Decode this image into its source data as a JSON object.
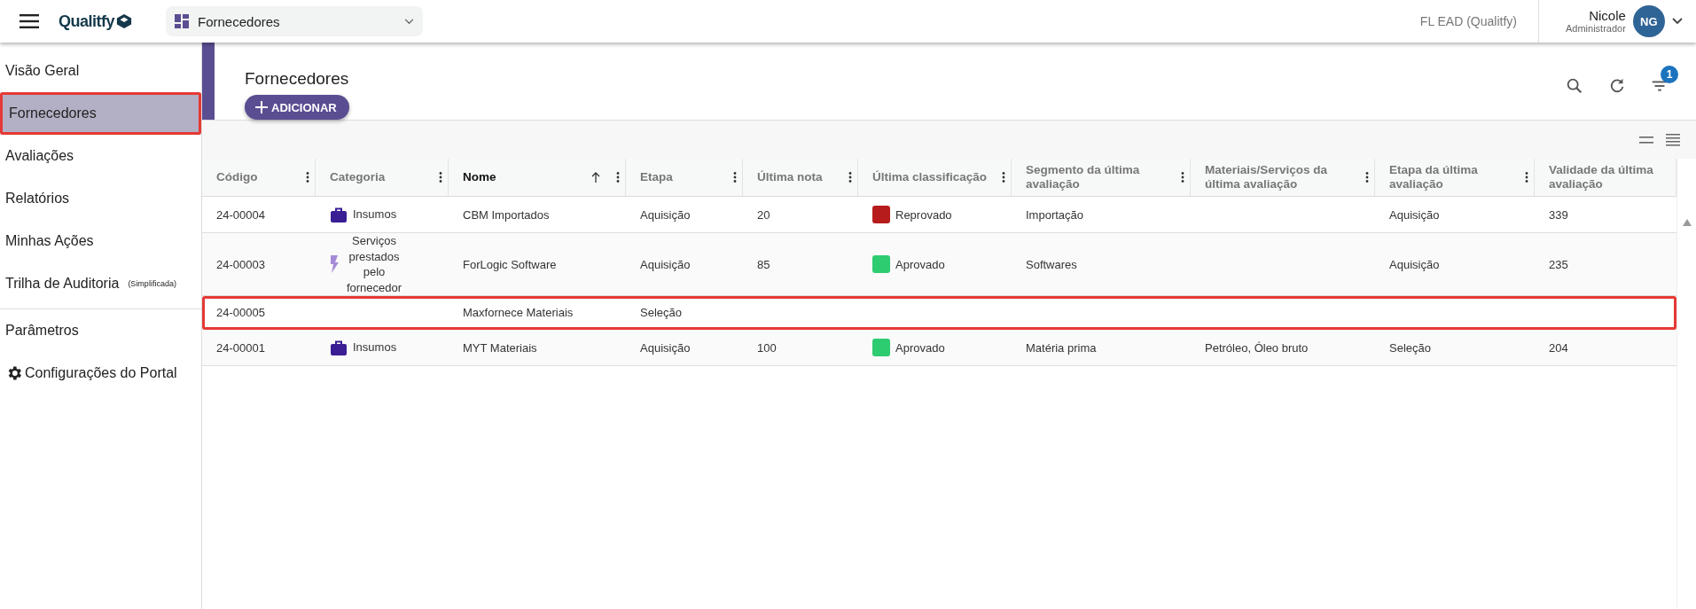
{
  "topbar": {
    "logo": "Qualitfy",
    "module": "Fornecedores",
    "tenant": "FL EAD (Qualitfy)",
    "user": {
      "name": "Nicole",
      "role": "Administrador",
      "initials": "NG"
    }
  },
  "sidebar": {
    "items": [
      {
        "label": "Visão Geral",
        "selected": false,
        "highlighted": false
      },
      {
        "label": "Fornecedores",
        "selected": true,
        "highlighted": true
      },
      {
        "label": "Avaliações",
        "selected": false,
        "highlighted": false
      },
      {
        "label": "Relatórios",
        "selected": false,
        "highlighted": false
      },
      {
        "label": "Minhas Ações",
        "selected": false,
        "highlighted": false
      },
      {
        "label": "Trilha de Auditoria",
        "note": "(Simplificada)",
        "selected": false,
        "highlighted": false
      },
      {
        "label": "Parâmetros",
        "divider_before": true,
        "selected": false,
        "highlighted": false
      },
      {
        "label": "Configurações do Portal",
        "kind": "gear",
        "selected": false,
        "highlighted": false
      }
    ]
  },
  "page": {
    "title": "Fornecedores",
    "add_button": "ADICIONAR",
    "filter_count": "1"
  },
  "table": {
    "columns": [
      {
        "label": "Código",
        "menu": true,
        "sorted": false
      },
      {
        "label": "Categoria",
        "menu": true,
        "sorted": false
      },
      {
        "label": "Nome",
        "menu": true,
        "sorted": true
      },
      {
        "label": "Etapa",
        "menu": true,
        "sorted": false
      },
      {
        "label": "Última nota",
        "menu": true,
        "sorted": false
      },
      {
        "label": "Última classificação",
        "menu": true,
        "sorted": false
      },
      {
        "label": "Segmento da última avaliação",
        "menu": true,
        "sorted": false
      },
      {
        "label": "Materiais/Serviços da última avaliação",
        "menu": true,
        "sorted": false
      },
      {
        "label": "Etapa da última avaliação",
        "menu": true,
        "sorted": false
      },
      {
        "label": "Validade da última avaliação",
        "menu": false,
        "sorted": false
      }
    ],
    "rows": [
      {
        "highlighted": false,
        "cells": [
          "24-00004",
          {
            "kind": "goods",
            "label": "Insumos"
          },
          "CBM Importados",
          "Aquisição",
          "20",
          {
            "kind": "status",
            "label": "Reprovado",
            "color": "#b71c1c"
          },
          "Importação",
          null,
          "Aquisição",
          "339"
        ]
      },
      {
        "highlighted": false,
        "cells": [
          "24-00003",
          {
            "kind": "service",
            "label": "Serviços prestados pelo fornecedor"
          },
          "ForLogic Software",
          "Aquisição",
          "85",
          {
            "kind": "status",
            "label": "Aprovado",
            "color": "#2ecc71"
          },
          "Softwares",
          null,
          "Aquisição",
          "235"
        ]
      },
      {
        "highlighted": true,
        "cells": [
          "24-00005",
          null,
          "Maxfornece Materiais",
          "Seleção",
          null,
          null,
          null,
          null,
          null,
          null
        ]
      },
      {
        "highlighted": false,
        "cells": [
          "24-00001",
          {
            "kind": "goods",
            "label": "Insumos"
          },
          "MYT Materiais",
          "Aquisição",
          "100",
          {
            "kind": "status",
            "label": "Aprovado",
            "color": "#2ecc71"
          },
          "Matéria prima",
          "Petróleo, Óleo bruto",
          "Seleção",
          "204"
        ]
      }
    ]
  }
}
